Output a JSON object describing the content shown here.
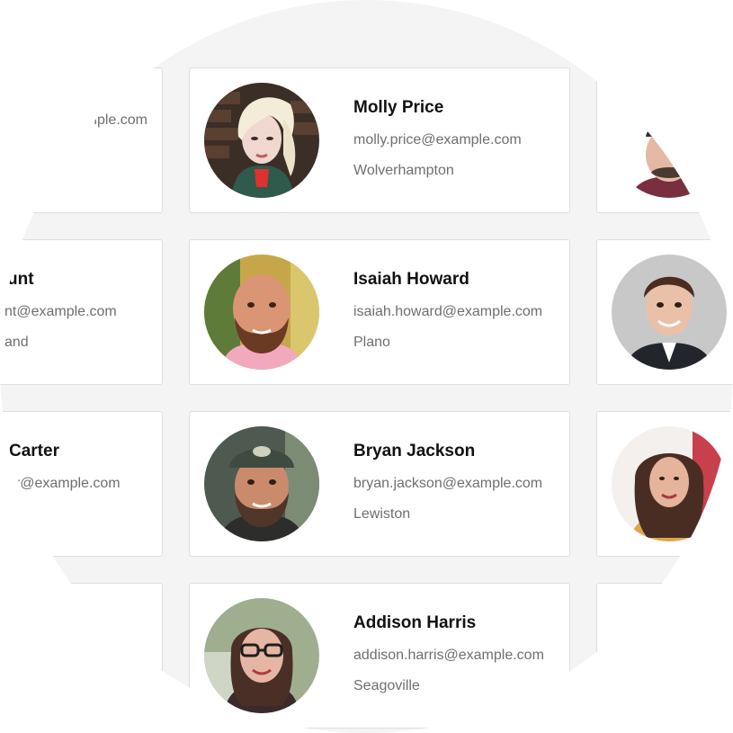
{
  "center_cards": [
    {
      "name": "Molly Price",
      "email": "molly.price@example.com",
      "city": "Wolverhampton",
      "avatar": "blonde-woman-photo"
    },
    {
      "name": "Isaiah Howard",
      "email": "isaiah.howard@example.com",
      "city": "Plano",
      "avatar": "bald-bearded-man-photo"
    },
    {
      "name": "Bryan Jackson",
      "email": "bryan.jackson@example.com",
      "city": "Lewiston",
      "avatar": "man-in-cap-photo"
    },
    {
      "name": "Addison Harris",
      "email": "addison.harris@example.com",
      "city": "Seagoville",
      "avatar": "woman-with-glasses-photo"
    }
  ],
  "left_cards": [
    {
      "name": "",
      "email": "xample.com",
      "city": ""
    },
    {
      "name": "unt",
      "email": "nt@example.com",
      "city": "and"
    },
    {
      "name": "Carter",
      "email": "er@example.com",
      "city": ""
    },
    {
      "name": "",
      "email": "",
      "city": ""
    }
  ],
  "right_cards": [
    {
      "avatar": "man-portrait-partial"
    },
    {
      "avatar": "young-man-in-suit-photo"
    },
    {
      "avatar": "brunette-woman-photo"
    },
    {
      "avatar": ""
    }
  ],
  "colors": {
    "background": "#f4f4f4",
    "card": "#ffffff",
    "border": "#dedede",
    "name_text": "#111111",
    "secondary_text": "#6f6f6f"
  }
}
